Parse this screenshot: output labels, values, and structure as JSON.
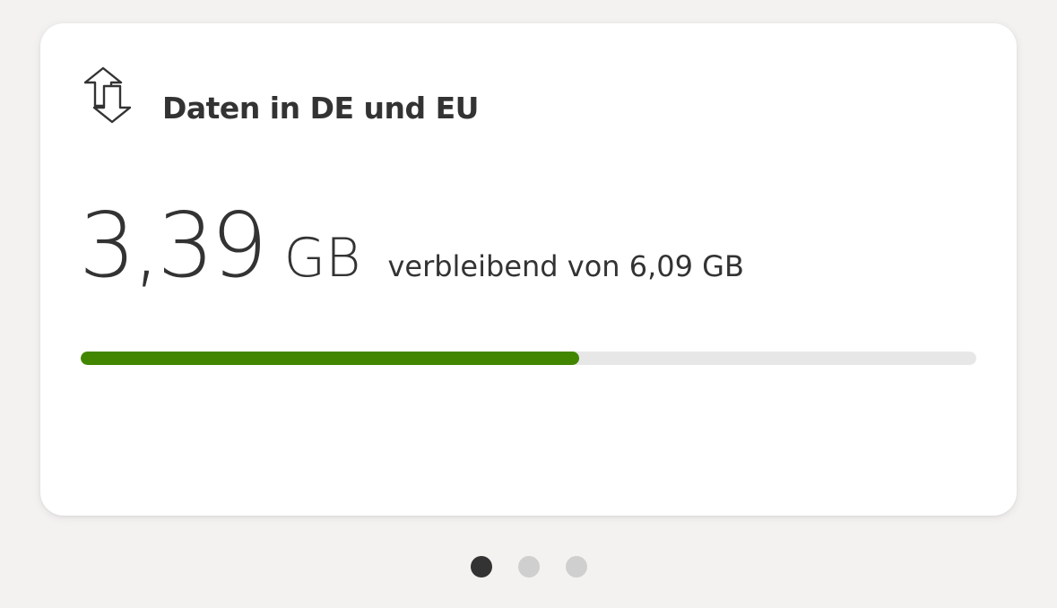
{
  "card": {
    "title": "Daten in DE und EU",
    "icon": "data-transfer-arrows-icon",
    "remaining_value": "3,39",
    "remaining_unit": "GB",
    "caption": "verbleibend von 6,09 GB",
    "remaining_fraction": 0.557
  },
  "pager": {
    "pages": 3,
    "active_index": 0
  },
  "colors": {
    "progress_fill": "#428600",
    "progress_track": "#e8e7e7",
    "dot_active": "#333333",
    "dot_inactive": "#cfcfcf"
  }
}
